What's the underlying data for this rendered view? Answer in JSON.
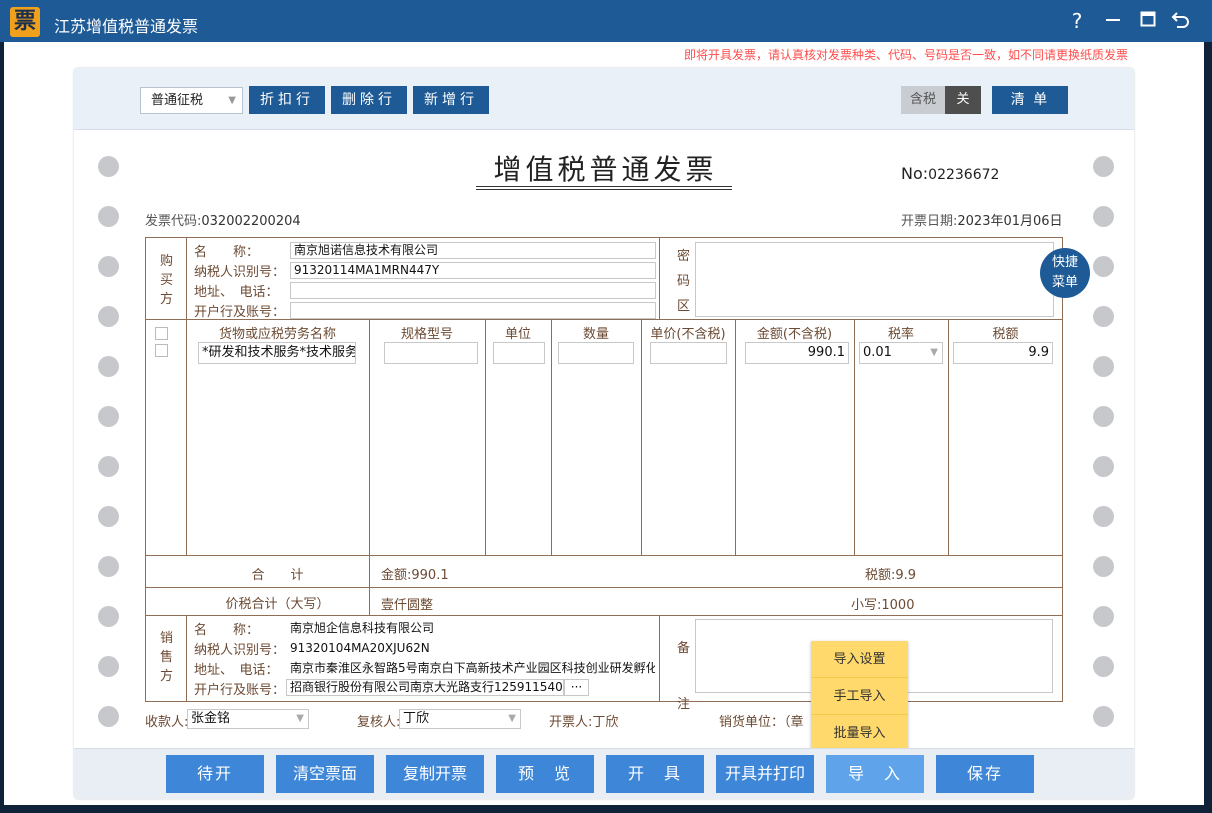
{
  "app": {
    "title": "江苏增值税普通发票",
    "logo_char": "票"
  },
  "titlebar_icons": [
    "help-icon",
    "minimize-icon",
    "maximize-icon",
    "back-icon"
  ],
  "notice": "即将开具发票，请认真核对发票种类、代码、号码是否一致，如不同请更换纸质发票",
  "toolbar": {
    "tax_type": "普通征税",
    "discount_row": "折扣行",
    "delete_row": "删除行",
    "add_row": "新增行",
    "tax_included_label": "含税",
    "tax_included_state": "关",
    "list_button": "清 单"
  },
  "invoice": {
    "title": "增值税普通发票",
    "no_label": "No:",
    "no_value": "02236672",
    "code_label": "发票代码:",
    "code_value": "032002200204",
    "date_label": "开票日期:",
    "date_value": "2023年01月06日"
  },
  "buyer": {
    "section_label": [
      "购",
      "买",
      "方"
    ],
    "name_label": "名　　称：",
    "name_value": "南京旭诺信息技术有限公司",
    "taxid_label": "纳税人识别号：",
    "taxid_value": "91320114MA1MRN447Y",
    "address_label": "地址、　电话：",
    "address_value": "",
    "bank_label": "开户行及账号：",
    "bank_value": "",
    "cipher_label": [
      "密",
      "码",
      "区"
    ]
  },
  "shortcut": {
    "line1": "快捷",
    "line2": "菜单"
  },
  "items": {
    "headers": [
      "货物或应税劳务名称",
      "规格型号",
      "单位",
      "数量",
      "单价(不含税)",
      "金额(不含税)",
      "税率",
      "税额"
    ],
    "row": {
      "name": "*研发和技术服务*技术服务费",
      "spec": "",
      "unit": "",
      "qty": "",
      "price": "",
      "amount": "990.1",
      "rate": "0.01",
      "tax": "9.9"
    }
  },
  "totals": {
    "total_label": "合　　计",
    "amount_text": "金额:990.1",
    "tax_text": "税额:9.9",
    "grand_label": "价税合计（大写）",
    "grand_upper": "壹仟圆整",
    "grand_lower": "小写:1000"
  },
  "seller": {
    "section_label": [
      "销",
      "售",
      "方"
    ],
    "name_label": "名　　称：",
    "name_value": "南京旭企信息科技有限公司",
    "taxid_label": "纳税人识别号：",
    "taxid_value": "91320104MA20XJU62N",
    "address_label": "地址、　电话：",
    "address_value": "南京市秦淮区永智路5号南京白下高新技术产业园区科技创业研发孵化",
    "bank_label": "开户行及账号：",
    "bank_value": "招商银行股份有限公司南京大光路支行125911540",
    "bank_more": "···",
    "remark_label": [
      "备",
      "注"
    ]
  },
  "signers": {
    "payee_label": "收款人:",
    "payee_value": "张金铭",
    "reviewer_label": "复核人:",
    "reviewer_value": "丁欣",
    "drawer_label": "开票人:",
    "drawer_value": "丁欣",
    "seller_unit_label": "销货单位：（",
    "seller_unit_tail": "章"
  },
  "import_menu": [
    "导入设置",
    "手工导入",
    "批量导入"
  ],
  "actions": [
    "待开",
    "清空票面",
    "复制开票",
    "预　览",
    "开　具",
    "开具并打印",
    "导　入",
    "保存"
  ],
  "colors": {
    "titlebar": "#1e5a96",
    "action_button": "#3d86d8",
    "notice": "#ff4d4d",
    "grid_line": "#8f6e55",
    "menu_bg": "#ffd96b"
  }
}
